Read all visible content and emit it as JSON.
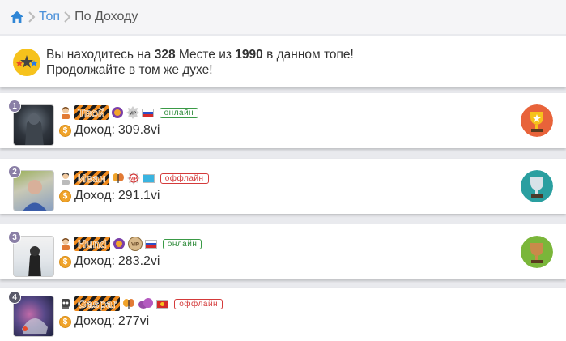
{
  "breadcrumb": {
    "home_icon": "home-icon",
    "items": [
      "Топ",
      "По Доходу"
    ]
  },
  "rank": {
    "prefix": "Вы находитесь на",
    "place": "328",
    "middle": "Месте из",
    "total": "1990",
    "suffix": "в данном топе!",
    "line2": "Продолжайте в том же духе!"
  },
  "users": [
    {
      "position": "1",
      "nick": "Твой",
      "income_label": "Доход:",
      "income": "309.8vi",
      "status": "онлайн",
      "trophy_color": "#e8633a"
    },
    {
      "position": "2",
      "nick": "Иван",
      "income_label": "Доход:",
      "income": "291.1vi",
      "status": "оффлайн",
      "trophy_color": "#2a9fa0"
    },
    {
      "position": "3",
      "nick": "Hund",
      "income_label": "Доход:",
      "income": "283.2vi",
      "status": "онлайн",
      "trophy_color": "#7ab63a"
    },
    {
      "position": "4",
      "nick": "Gaspar",
      "income_label": "Доход:",
      "income": "277vi",
      "status": "оффлайн"
    }
  ],
  "coin_symbol": "$",
  "colors": {
    "link": "#4a90d9",
    "online": "#2e8b3a",
    "offline": "#d43a3a",
    "coin": "#f0a32a"
  }
}
